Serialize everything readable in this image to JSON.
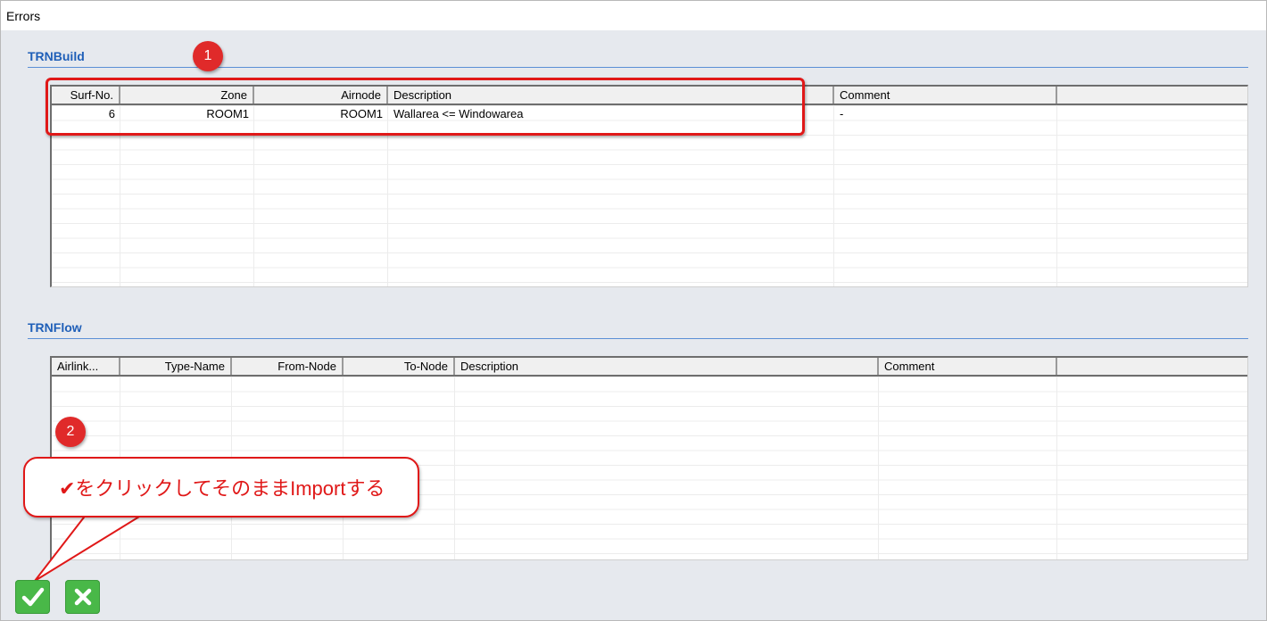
{
  "window": {
    "title": "Errors"
  },
  "trnbuild": {
    "title": "TRNBuild",
    "columns": [
      "Surf-No.",
      "Zone",
      "Airnode",
      "Description",
      "Comment"
    ],
    "rows": [
      {
        "surf_no": "6",
        "zone": "ROOM1",
        "airnode": "ROOM1",
        "description": "Wallarea <= Windowarea",
        "comment": "-"
      }
    ]
  },
  "trnflow": {
    "title": "TRNFlow",
    "columns": [
      "Airlink...",
      "Type-Name",
      "From-Node",
      "To-Node",
      "Description",
      "Comment"
    ],
    "rows": []
  },
  "annotations": {
    "badge1": "1",
    "badge2": "2",
    "callout": "✔をクリックしてそのままImportする",
    "accent": "#e01818"
  },
  "buttons": {
    "ok_icon": "check-icon",
    "cancel_icon": "x-icon",
    "color": "#49b848"
  }
}
